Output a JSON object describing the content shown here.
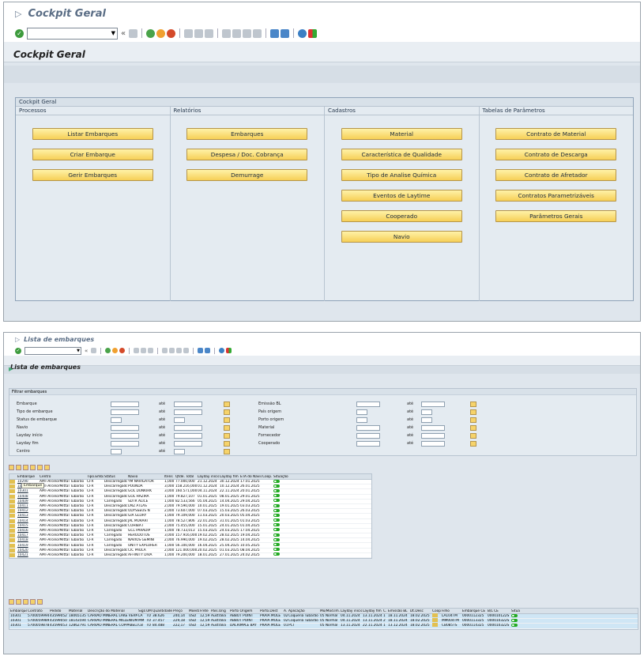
{
  "w1": {
    "title": "Cockpit Geral",
    "header_title": "Cockpit Geral",
    "group_title": "Cockpit Geral",
    "cols": [
      {
        "head": "Processos",
        "buttons": [
          "Listar Embarques",
          "Criar Embarque",
          "Gerir Embarques"
        ]
      },
      {
        "head": "Relatórios",
        "buttons": [
          "Embarques",
          "Despesa / Doc. Cobrança",
          "Demurrage"
        ]
      },
      {
        "head": "Cadastros",
        "buttons": [
          "Material",
          "Característica de Qualidade",
          "Tipo de Analise Química",
          "Eventos de Laytime",
          "Cooperado",
          "Navio"
        ]
      },
      {
        "head": "Tabelas de Parâmetros",
        "buttons": [
          "Contrato de Material",
          "Contrato de Descarga",
          "Contrato de Afretador",
          "Contratos Parametrizáveis",
          "Parâmetros Gerais"
        ]
      }
    ]
  },
  "w2": {
    "title": "Lista de embarques",
    "header_title": "Lista de embarques",
    "filter_title": "Filtrar embarques",
    "ate": "até",
    "filters_left": [
      "Embarque",
      "Tipo de embarque",
      "Status de embarque",
      "Navio",
      "Layday início",
      "Layday fim",
      "Centro"
    ],
    "filters_right": [
      "Emissão BL",
      "País origem",
      "Porto origem",
      "Material",
      "Fornecedor",
      "Cooperado"
    ],
    "table1": {
      "headers": [
        "Embarque",
        "Centro",
        "Tipo.Embar",
        "Status",
        "Navio",
        "Itens",
        "Qtde. Total",
        "Layday início",
        "Layday fim",
        "ETA do Navio",
        "Coop.",
        "Situação"
      ],
      "tooltip": "Embarque",
      "rows": [
        [
          "10290",
          "AMT-ArcelorMittal Tubarão",
          "CFR",
          "Descarregado",
          "YM NAVIGATOR",
          "1,000",
          "77.000,000",
          "21.12.2024",
          "30.12.2024",
          "17.01.2025"
        ],
        [
          "10300",
          "AMT-ArcelorMittal Tubarão",
          "CFR",
          "Descarregado",
          "POUNDA",
          "3,000",
          "158.216,000",
          "01.12.2024",
          "10.12.2024",
          "26.01.2025"
        ],
        [
          "10301",
          "AMT-ArcelorMittal Tubarão",
          "CFR",
          "Descarregado",
          "GOL DUNKIRK",
          "3,000",
          "160.571,000",
          "04.11.2024",
          "22.11.2024",
          "20.01.2025"
        ],
        [
          "10408",
          "AMT-ArcelorMittal Tubarão",
          "CFR",
          "Descarregado",
          "GOL HAZIRA",
          "1,000",
          "79.827,107",
          "01.01.2025",
          "08.01.2025",
          "29.01.2025"
        ],
        [
          "10409",
          "AMT-ArcelorMittal Tubarão",
          "CFR",
          "Carregado",
          "SDTR ALICE",
          "1,000",
          "82.533,566",
          "05.04.2025",
          "14.04.2025",
          "29.04.2025"
        ],
        [
          "10411",
          "AMT-ArcelorMittal Tubarão",
          "CFR",
          "Descarregado",
          "LMZ ATLAS",
          "2,000",
          "79.590,000",
          "10.01.2025",
          "19.01.2025",
          "03.03.2025"
        ],
        [
          "10412",
          "AMT-ArcelorMittal Tubarão",
          "CFR",
          "Descarregado",
          "ODYSSEUS N",
          "2,000",
          "73.607,000",
          "07.03.2025",
          "15.03.2025",
          "26.03.2025"
        ],
        [
          "10413",
          "AMT-ArcelorMittal Tubarão",
          "CFR",
          "Descarregado",
          "GIA GLORY",
          "1,000",
          "79.109,000",
          "11.03.2025",
          "20.03.2025",
          "05.04.2025"
        ],
        [
          "10414",
          "AMT-ArcelorMittal Tubarão",
          "CFR",
          "Descarregado",
          "JAL MURARI",
          "1,000",
          "78.527,806",
          "22.01.2025",
          "31.01.2025",
          "01.03.2025"
        ],
        [
          "10415",
          "AMT-ArcelorMittal Tubarão",
          "CFR",
          "Descarregado",
          "COHIBA I",
          "2,000",
          "75.455,000",
          "15.01.2025",
          "24.01.2025",
          "01.04.2025"
        ],
        [
          "10416",
          "AMT-ArcelorMittal Tubarão",
          "CFR",
          "Carregado",
          "GCL PARADIP",
          "1,000",
          "78.733,013",
          "15.03.2025",
          "24.03.2025",
          "17.04.2025"
        ],
        [
          "10417",
          "AMT-ArcelorMittal Tubarão",
          "CFR",
          "Carregado",
          "HERODOTUS",
          "3,000",
          "157.916,000",
          "19.02.2025",
          "28.02.2025",
          "19.04.2025"
        ],
        [
          "10418",
          "AMT-ArcelorMittal Tubarão",
          "CFR",
          "Carregado",
          "NAVIOS GEMINI",
          "2,000",
          "76.990,000",
          "19.02.2025",
          "28.02.2025",
          "14.04.2025"
        ],
        [
          "10419",
          "AMT-ArcelorMittal Tubarão",
          "CFR",
          "Carregado",
          "UNITY EXPLORER",
          "1,000",
          "56.100,000",
          "16.04.2025",
          "25.04.2025",
          "10.05.2025"
        ],
        [
          "10420",
          "AMT-ArcelorMittal Tubarão",
          "CFR",
          "Descarregado",
          "CIC PAOLA",
          "2,000",
          "121.000,000",
          "20.02.2025",
          "01.03.2025",
          "08.04.2025"
        ],
        [
          "10421",
          "AMT-ArcelorMittal Tubarão",
          "CFR",
          "Descarregado",
          "AFFINITY DIVA",
          "1,000",
          "79.200,000",
          "18.01.2025",
          "27.01.2025",
          "24.02.2025"
        ]
      ]
    },
    "table2": {
      "headers": [
        "Embarque",
        "Contrato",
        "Pedido",
        "Material",
        "Descrição do Material",
        "Sigla",
        "UM",
        "Quantidade",
        "Preço",
        "Moeda",
        "Frete",
        "País.Orig",
        "Porto Origem",
        "Porto.Dest",
        "A.",
        "Aplicação",
        "Mo/Mod.Im.",
        "Layday início",
        "Layday fim",
        "C.",
        "Emissão BL",
        "Dt.Desc",
        "Coop.",
        "Filho",
        "Embarque CE",
        "B/L CE",
        "Situa"
      ],
      "rows": [
        [
          "10301",
          "5700059994",
          "43599052",
          "18065135",
          "CARVÃO MINERAL LAKE VERMO...",
          "LA",
          "TO",
          "38.626",
          "240,14",
          "USD",
          "12,59",
          "Austrália",
          "ABBOT POINT",
          "PRAIA MOLE",
          "02",
          "Coqueria Tubarão",
          "05 Normal",
          "04.11.2024",
          "13.11.2024",
          "1",
          "18.11.2024",
          "18.02.2025",
          "LA104TM",
          "0000112325",
          "000010122S"
        ],
        [
          "10301",
          "5700059989",
          "43599050",
          "18143594",
          "CARVÃO MINERAL MILLENIUM A...",
          "MM",
          "TO",
          "37.457",
          "229,18",
          "USD",
          "12,59",
          "Austrália",
          "ABBOT POINT",
          "PRAIA MOLE",
          "02",
          "Coqueria Tubarão",
          "05 Normal",
          "04.11.2024",
          "13.11.2024",
          "2",
          "18.11.2024",
          "18.02.2025",
          "MM004TM",
          "0000113325",
          "000010322S"
        ],
        [
          "10301",
          "5700059878",
          "43599053",
          "12862791",
          "CARVÃO MINERAL COPPABELLA",
          "CB",
          "TO",
          "84.488",
          "222,17",
          "USD",
          "12,59",
          "Austrália",
          "DALRIMPLE BAY",
          "PRAIA MOLE",
          "01",
          "PCI",
          "05 Normal",
          "13.11.2024",
          "22.11.2024",
          "1",
          "13.12.2024",
          "18.02.2025",
          "CB085TS",
          "0000114325",
          "000010322S"
        ]
      ]
    }
  }
}
